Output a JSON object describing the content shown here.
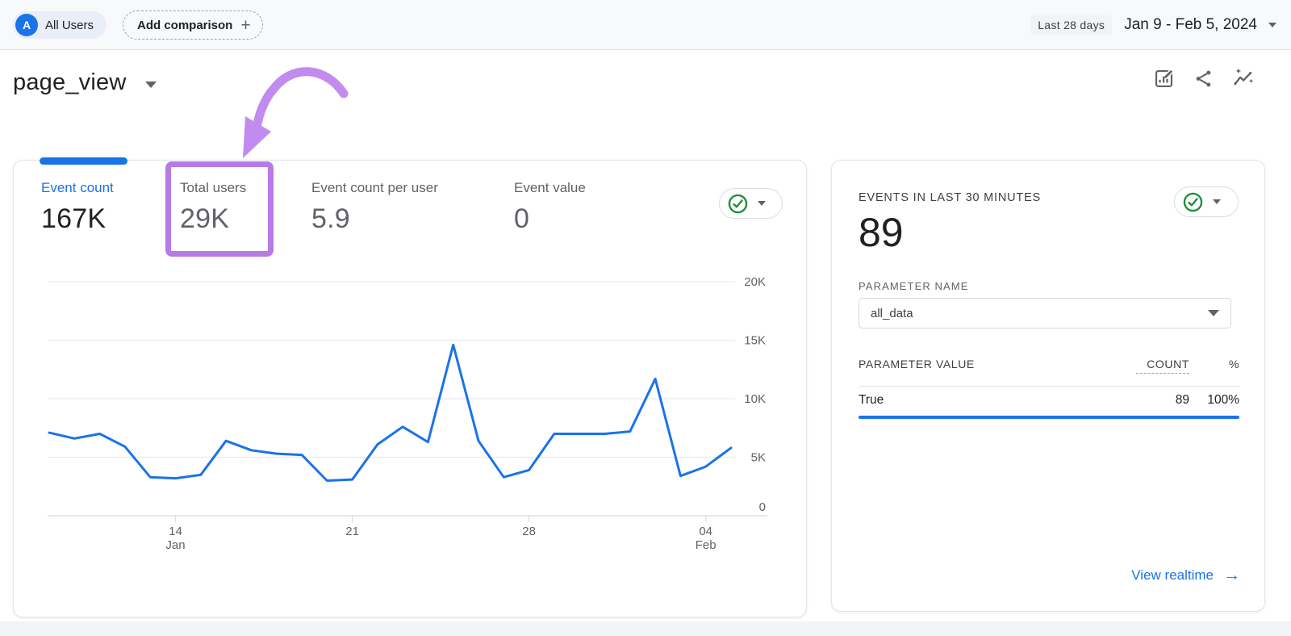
{
  "topbar": {
    "audience": {
      "avatar_letter": "A",
      "label": "All Users"
    },
    "add_comparison": {
      "label": "Add comparison",
      "plus": "+"
    },
    "date": {
      "preset": "Last 28 days",
      "range": "Jan 9 - Feb 5, 2024"
    }
  },
  "header": {
    "title": "page_view"
  },
  "metrics": {
    "tabs": [
      {
        "label": "Event count",
        "value": "167K",
        "active": true
      },
      {
        "label": "Total users",
        "value": "29K",
        "highlighted": true
      },
      {
        "label": "Event count per user",
        "value": "5.9"
      },
      {
        "label": "Event value",
        "value": "0"
      }
    ]
  },
  "chart_data": {
    "type": "line",
    "title": "page_view event count per day",
    "x": [
      "Jan 9",
      "Jan 10",
      "Jan 11",
      "Jan 12",
      "Jan 13",
      "Jan 14",
      "Jan 15",
      "Jan 16",
      "Jan 17",
      "Jan 18",
      "Jan 19",
      "Jan 20",
      "Jan 21",
      "Jan 22",
      "Jan 23",
      "Jan 24",
      "Jan 25",
      "Jan 26",
      "Jan 27",
      "Jan 28",
      "Jan 29",
      "Jan 30",
      "Jan 31",
      "Feb 1",
      "Feb 2",
      "Feb 3",
      "Feb 4",
      "Feb 5"
    ],
    "values": [
      7100,
      6600,
      7000,
      5900,
      3300,
      3200,
      3500,
      6400,
      5600,
      5300,
      5200,
      3000,
      3100,
      6100,
      7600,
      6300,
      14600,
      6400,
      3300,
      3900,
      7000,
      7000,
      7000,
      7200,
      11700,
      3400,
      4200,
      5800
    ],
    "ylim": [
      0,
      20000
    ],
    "yticks": [
      {
        "label": "0",
        "value": 0
      },
      {
        "label": "5K",
        "value": 5000
      },
      {
        "label": "10K",
        "value": 10000
      },
      {
        "label": "15K",
        "value": 15000
      },
      {
        "label": "20K",
        "value": 20000
      }
    ],
    "xticks": [
      {
        "index": 5,
        "line1": "14",
        "line2": "Jan"
      },
      {
        "index": 12,
        "line1": "21",
        "line2": ""
      },
      {
        "index": 19,
        "line1": "28",
        "line2": ""
      },
      {
        "index": 26,
        "line1": "04",
        "line2": "Feb"
      }
    ],
    "line_color": "#1a73e8",
    "grid": true,
    "legend": false
  },
  "realtime": {
    "title": "EVENTS IN LAST 30 MINUTES",
    "value": "89",
    "parameter_name_label": "PARAMETER NAME",
    "parameter_name_value": "all_data",
    "table": {
      "value_header": "PARAMETER VALUE",
      "count_header": "COUNT",
      "percent_header": "%",
      "rows": [
        {
          "value": "True",
          "count": "89",
          "percent": "100%"
        }
      ]
    },
    "view_realtime": "View realtime",
    "arrow": "→"
  },
  "colors": {
    "accent_blue": "#1a73e8",
    "green_check": "#1e8e3e",
    "annotation_box_purple": "#b87ae6",
    "annotation_arrow_purple": "#c28bef",
    "text_dark": "#202124",
    "text_gray": "#5f6368",
    "topbar_bg": "#f8f9fa"
  }
}
